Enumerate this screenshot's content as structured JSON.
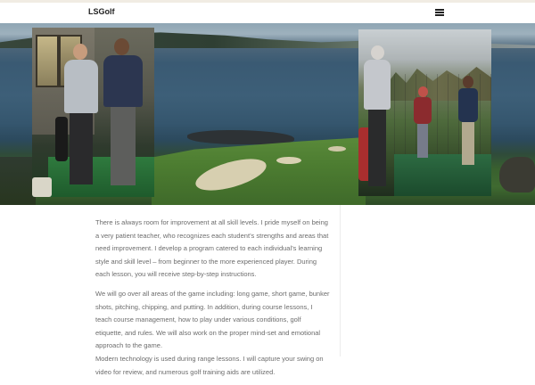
{
  "header": {
    "site_title": "LSGolf",
    "menu_icon": "hamburger-menu-icon"
  },
  "hero": {
    "description_icon": "photo-collage"
  },
  "content": {
    "paragraphs": [
      "There is always room for improvement at all skill levels. I pride myself on being a very patient teacher, who recognizes each student’s strengths and areas that need improvement. I develop a program catered to each individual’s learning style and skill level – from beginner to the more experienced player. During each lesson, you will receive step-by-step instructions.",
      "We will go over all areas of the game including: long game, short game, bunker shots, pitching, chipping, and putting. In addition, during course lessons, I teach course management, how to play under various conditions, golf etiquette, and rules. We will also work on the proper mind-set and emotional approach to the game.",
      "Modern technology is used during range lessons. I will capture your swing on video for review, and numerous golf training aids are utilized."
    ]
  }
}
